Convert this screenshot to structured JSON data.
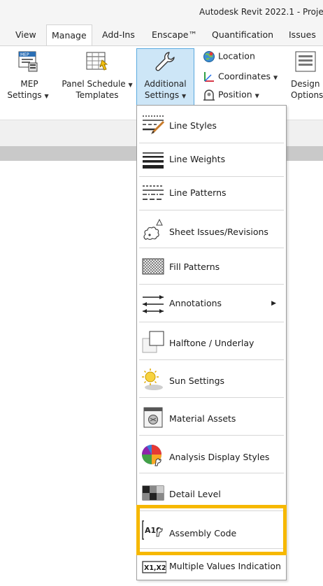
{
  "window": {
    "title": "Autodesk Revit 2022.1 - Proje"
  },
  "tabs": [
    {
      "label": "View"
    },
    {
      "label": "Manage"
    },
    {
      "label": "Add-Ins"
    },
    {
      "label": "Enscape™"
    },
    {
      "label": "Quantification"
    },
    {
      "label": "Issues"
    }
  ],
  "ribbon": {
    "mep_settings": {
      "line1": "MEP",
      "line2": "Settings"
    },
    "panel_schedule": {
      "line1": "Panel Schedule",
      "line2": "Templates"
    },
    "additional_settings": {
      "line1": "Additional",
      "line2": "Settings"
    },
    "location": "Location",
    "coordinates": "Coordinates",
    "position": "Position",
    "design_options": {
      "line1": "Design",
      "line2": "Options"
    }
  },
  "menu": {
    "items": [
      {
        "label": "Line Styles"
      },
      {
        "label": "Line Weights"
      },
      {
        "label": "Line Patterns"
      },
      {
        "label": "Sheet Issues/Revisions"
      },
      {
        "label": "Fill Patterns"
      },
      {
        "label": "Annotations"
      },
      {
        "label": "Halftone / Underlay"
      },
      {
        "label": "Sun Settings"
      },
      {
        "label": "Material Assets"
      },
      {
        "label": "Analysis Display Styles"
      },
      {
        "label": "Detail Level"
      },
      {
        "label": "Assembly Code"
      },
      {
        "label": "Multiple Values Indication"
      }
    ],
    "assembly_icon_text": "A10",
    "multi_icon_text": "X1,X2"
  },
  "colors": {
    "highlight": "#f6b800",
    "selected_button": "#cde6f7",
    "selected_border": "#5aa9df"
  }
}
